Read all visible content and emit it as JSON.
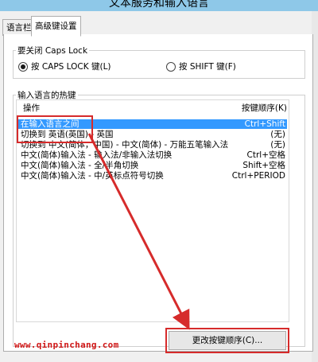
{
  "window": {
    "title": "文本服务和输入语言"
  },
  "tabs": [
    {
      "label": "语言栏",
      "selected": false
    },
    {
      "label": "高级键设置",
      "selected": true
    }
  ],
  "caps_group": {
    "title": "要关闭 Caps Lock",
    "options": [
      {
        "label": "按 CAPS LOCK 键(L)",
        "selected": true
      },
      {
        "label": "按 SHIFT 键(F)",
        "selected": false
      }
    ]
  },
  "hotkeys_group": {
    "title": "输入语言的热键",
    "columns": {
      "action": "操作",
      "key_sequence": "按键顺序(K)"
    },
    "rows": [
      {
        "action": "在输入语言之间",
        "keys": "Ctrl+Shift",
        "selected": true
      },
      {
        "action": "切换到 英语(英国) - 英国",
        "keys": "(无)",
        "selected": false
      },
      {
        "action": "切换到 中文(简体，中国) - 中文(简体) - 万能五笔输入法",
        "keys": "(无)",
        "selected": false
      },
      {
        "action": "中文(简体)输入法 - 输入法/非输入法切换",
        "keys": "Ctrl+空格",
        "selected": false
      },
      {
        "action": "中文(简体)输入法 - 全/半角切换",
        "keys": "Shift+空格",
        "selected": false
      },
      {
        "action": "中文(简体)输入法 - 中/英标点符号切换",
        "keys": "Ctrl+PERIOD",
        "selected": false
      }
    ],
    "change_button": "更改按键顺序(C)..."
  },
  "watermark": "www.qinpinchang.com",
  "annotation_color": "#d62b2b",
  "selection_color": "#3399ff"
}
